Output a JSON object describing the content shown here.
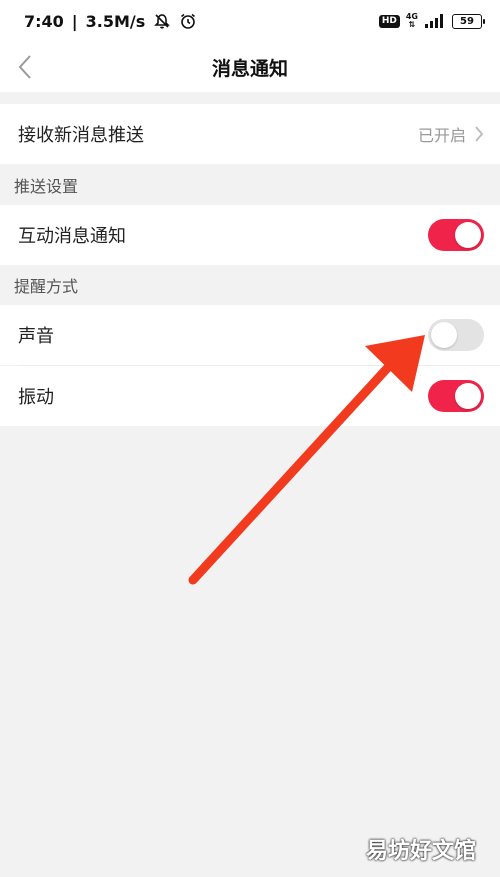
{
  "status_bar": {
    "time": "7:40",
    "speed": "3.5M/s",
    "hd": "HD",
    "network": "4G",
    "battery": "59",
    "icons": [
      "mute-icon",
      "alarm-icon",
      "signal-icon",
      "battery-icon"
    ]
  },
  "header": {
    "title": "消息通知",
    "back_icon": "chevron-left-icon"
  },
  "receive_push": {
    "label": "接收新消息推送",
    "value": "已开启"
  },
  "push_settings": {
    "header": "推送设置",
    "interaction_label": "互动消息通知",
    "interaction_on": true
  },
  "reminder": {
    "header": "提醒方式",
    "sound_label": "声音",
    "sound_on": false,
    "vibrate_label": "振动",
    "vibrate_on": true
  },
  "colors": {
    "accent": "#f0234a",
    "toggle_off": "#e3e3e3",
    "annotation_arrow": "#f23a1e"
  },
  "watermark": "易坊好文馆"
}
